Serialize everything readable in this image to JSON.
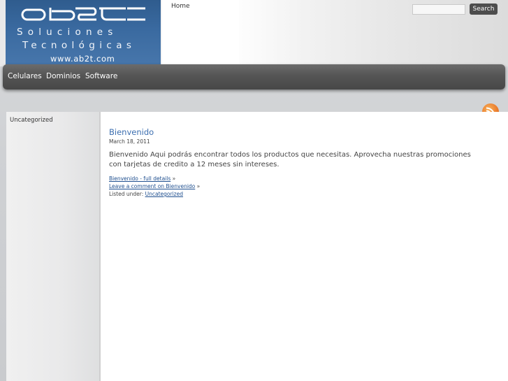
{
  "logo": {
    "mark": "ab2t",
    "line1": "Soluciones",
    "line2": "Tecnológicas",
    "url": "www.ab2t.com",
    "colors": {
      "bg_top": "#2f5c8e",
      "bg_bottom": "#4776ab",
      "text": "#ffffff"
    }
  },
  "header": {
    "home_label": "Home"
  },
  "search": {
    "placeholder": "",
    "value": "",
    "button_label": "Search"
  },
  "nav": {
    "items": [
      "Celulares",
      "Dominios",
      "Software"
    ]
  },
  "sidebar": {
    "categories": [
      "Uncategorized"
    ]
  },
  "post": {
    "title": "Bienvenido",
    "date": "March 18, 2011",
    "body": "Bienvenido Aqui podrás encontrar todos los productos que necesitas. Aprovecha nuestras promociones con tarjetas de credito a 12 meses sin intereses.",
    "details_link": "Bienvenido - full details",
    "comment_link": "Leave a comment on Bienvenido",
    "raquo": "»",
    "listed_under_label": "Listed under:",
    "category_link": "Uncategorized"
  },
  "icons": {
    "rss": "rss-feed-icon"
  },
  "colors": {
    "link": "#3d6fb0",
    "nav_bg": "#555555",
    "rss": "#e9792a"
  }
}
